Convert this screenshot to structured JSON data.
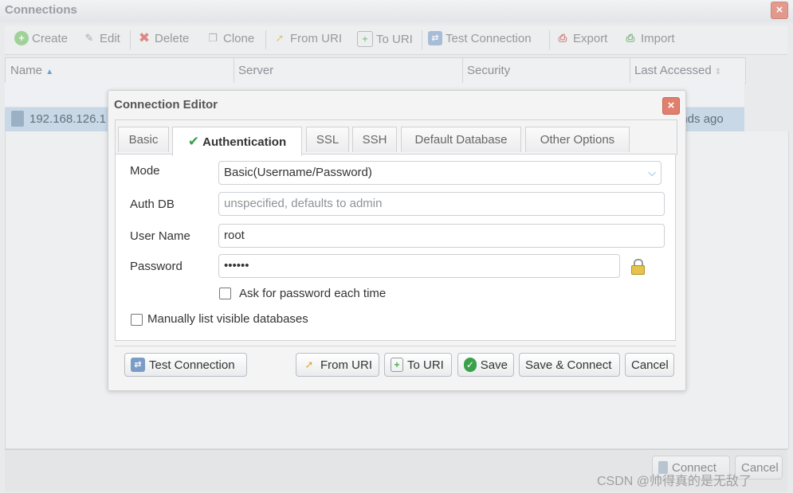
{
  "window": {
    "title": "Connections",
    "close_label": "×"
  },
  "toolbar": {
    "create": "Create",
    "edit": "Edit",
    "delete": "Delete",
    "clone": "Clone",
    "from_uri": "From URI",
    "to_uri": "To URI",
    "test_connection": "Test Connection",
    "export": "Export",
    "import": "Import"
  },
  "grid": {
    "columns": [
      "Name",
      "Server",
      "Security",
      "Last Accessed"
    ],
    "sorted_column": "Name",
    "rows": [
      {
        "name": "192.168.126.1",
        "last_accessed": "onds ago"
      }
    ]
  },
  "outer_footer": {
    "connect": "Connect",
    "cancel": "Cancel"
  },
  "watermark": "CSDN @帅得真的是无敌了",
  "dialog": {
    "title": "Connection Editor",
    "close_label": "×",
    "tabs": [
      "Basic",
      "Authentication",
      "SSL",
      "SSH",
      "Default Database",
      "Other Options"
    ],
    "active_tab": "Authentication",
    "form": {
      "mode_label": "Mode",
      "mode_value": "Basic(Username/Password)",
      "authdb_label": "Auth DB",
      "authdb_placeholder": "unspecified, defaults to admin",
      "username_label": "User Name",
      "username_value": "root",
      "password_label": "Password",
      "password_value": "••••••",
      "ask_password_label": "Ask for password each time",
      "ask_password_checked": false,
      "manual_dbs_label": "Manually list visible databases",
      "manual_dbs_checked": false
    },
    "footer": {
      "test_connection": "Test Connection",
      "from_uri": "From URI",
      "to_uri": "To URI",
      "save": "Save",
      "save_connect": "Save & Connect",
      "cancel": "Cancel"
    }
  },
  "colors": {
    "accent_blue": "#4aa3df",
    "close_red": "#e07f6e",
    "selected_row": "#c9d8e6",
    "check_green": "#3aa14a"
  }
}
